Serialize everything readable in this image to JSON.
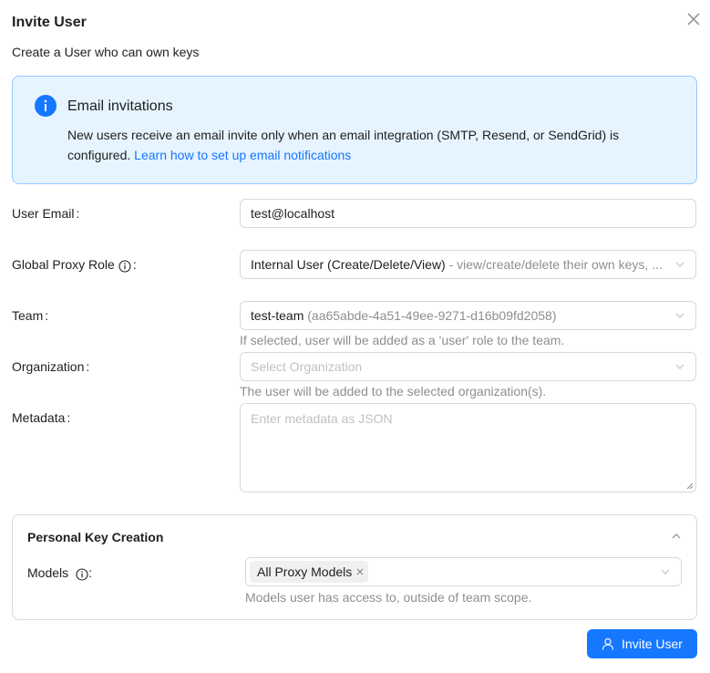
{
  "modal": {
    "title": "Invite User",
    "subtitle": "Create a User who can own keys"
  },
  "alert": {
    "title": "Email invitations",
    "description": "New users receive an email invite only when an email integration (SMTP, Resend, or SendGrid) is configured.",
    "link_text": "Learn how to set up email notifications",
    "accent": "#1677ff",
    "background": "#e6f4ff"
  },
  "form": {
    "email": {
      "label": "User Email",
      "value": "test@localhost"
    },
    "role": {
      "label": "Global Proxy Role",
      "value": "Internal User (Create/Delete/View)",
      "suffix": " - view/create/delete their own keys, ..."
    },
    "team": {
      "label": "Team",
      "value": "test-team",
      "suffix": " (aa65abde-4a51-49ee-9271-d16b09fd2058)",
      "help": "If selected, user will be added as a 'user' role to the team."
    },
    "organization": {
      "label": "Organization",
      "placeholder": "Select Organization",
      "help": "The user will be added to the selected organization(s)."
    },
    "metadata": {
      "label": "Metadata",
      "placeholder": "Enter metadata as JSON"
    },
    "colon": ":"
  },
  "personal_key": {
    "title": "Personal Key Creation",
    "models_label": "Models",
    "models_tag": "All Proxy Models",
    "models_help": "Models user has access to, outside of team scope."
  },
  "submit": {
    "label": "Invite User"
  },
  "icons": {
    "close": "close-icon",
    "info": "info-icon",
    "chevron": "chevron-down-icon",
    "user": "user-icon"
  }
}
